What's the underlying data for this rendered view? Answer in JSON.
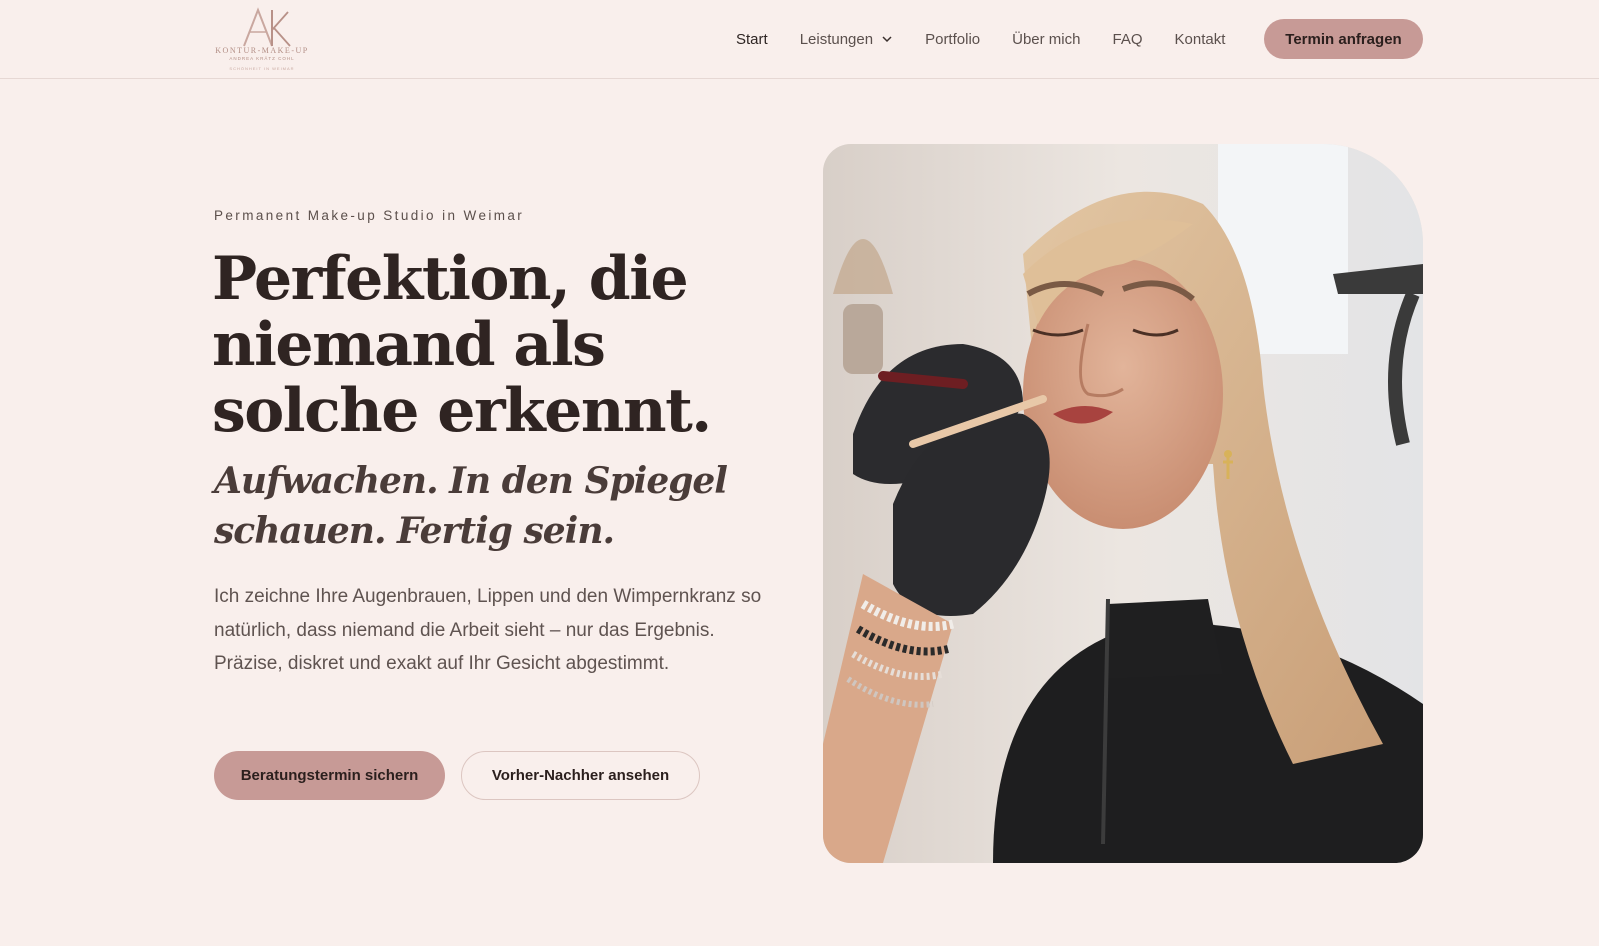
{
  "header": {
    "logo": {
      "monogram": "AK",
      "name": "KONTUR-MAKE-UP",
      "tagline": "ANDREA KRÄTZ COHL",
      "location": "SCHÖNHEIT IN WEIMAR"
    },
    "nav": [
      {
        "label": "Start",
        "active": true
      },
      {
        "label": "Leistungen",
        "has_dropdown": true
      },
      {
        "label": "Portfolio"
      },
      {
        "label": "Über mich"
      },
      {
        "label": "FAQ"
      },
      {
        "label": "Kontakt"
      }
    ],
    "cta_label": "Termin anfragen"
  },
  "hero": {
    "eyebrow": "Permanent Make-up Studio in Weimar",
    "headline": "Perfektion, die niemand als solche erkennt.",
    "subheadline": "Aufwachen. In den Spiegel schauen. Fertig sein.",
    "body": "Ich zeichne Ihre Augenbrauen, Lippen und den Wimpernkranz so natürlich, dass niemand die Arbeit sieht – nur das Ergebnis. Präzise, diskret und exakt auf Ihr Gesicht abgestimmt.",
    "primary_button": "Beratungstermin sichern",
    "secondary_button": "Vorher-Nachher ansehen"
  },
  "colors": {
    "background": "#f9efec",
    "accent": "#c79a96",
    "text_dark": "#2f2422"
  }
}
